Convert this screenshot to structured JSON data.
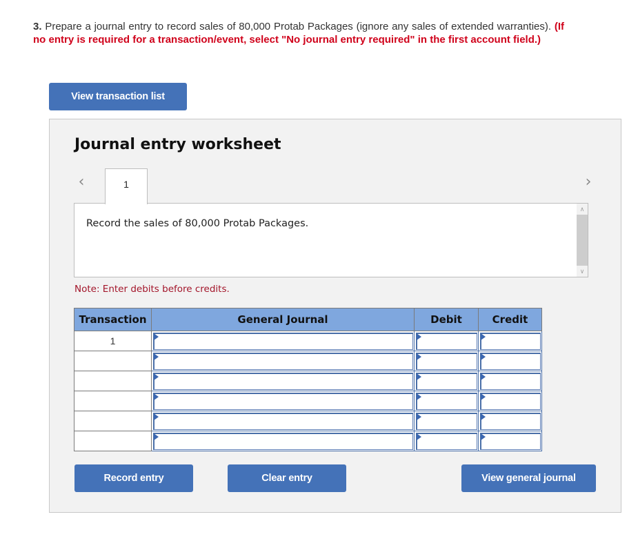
{
  "question": {
    "number": "3.",
    "text": "Prepare a journal entry to record sales of 80,000 Protab Packages (ignore any sales of extended warranties).",
    "instruction": "(If no entry is required for a transaction/event, select \"No journal entry required\" in the first account field.)"
  },
  "buttons": {
    "view_transaction_list": "View transaction list",
    "record_entry": "Record entry",
    "clear_entry": "Clear entry",
    "view_general_journal": "View general journal"
  },
  "worksheet": {
    "title": "Journal entry worksheet",
    "prev_icon": "chevron-left",
    "next_icon": "chevron-right",
    "tabs": [
      {
        "label": "1",
        "active": true
      }
    ],
    "description": "Record the sales of 80,000 Protab Packages.",
    "note": "Note: Enter debits before credits."
  },
  "journal_table": {
    "headers": {
      "transaction": "Transaction",
      "general_journal": "General Journal",
      "debit": "Debit",
      "credit": "Credit"
    },
    "rows": [
      {
        "transaction": "1",
        "account": "",
        "debit": "",
        "credit": ""
      },
      {
        "transaction": "",
        "account": "",
        "debit": "",
        "credit": ""
      },
      {
        "transaction": "",
        "account": "",
        "debit": "",
        "credit": ""
      },
      {
        "transaction": "",
        "account": "",
        "debit": "",
        "credit": ""
      },
      {
        "transaction": "",
        "account": "",
        "debit": "",
        "credit": ""
      },
      {
        "transaction": "",
        "account": "",
        "debit": "",
        "credit": ""
      }
    ]
  },
  "colors": {
    "button_blue": "#4472b8",
    "header_blue": "#7fa7de",
    "instruction_red": "#d0021b",
    "note_red": "#a3152a",
    "panel_bg": "#f2f2f2"
  }
}
